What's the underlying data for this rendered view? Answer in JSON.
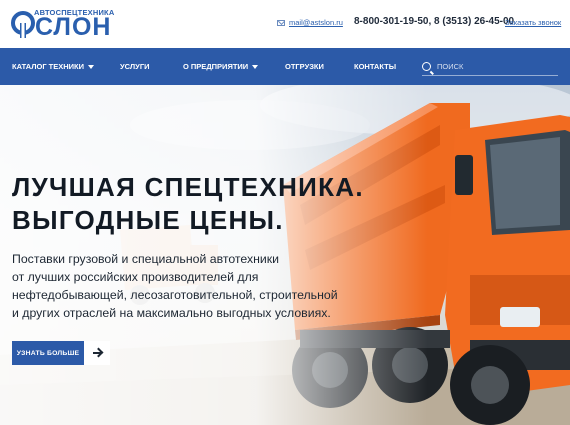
{
  "header": {
    "logo_small": "АВТОСПЕЦТЕХНИКА",
    "logo_big": "СЛОН",
    "email": "mail@astslon.ru",
    "phones": "8-800-301-19-50,  8 (3513) 26-45-00",
    "callback_label": "Заказать звонок"
  },
  "nav": {
    "items": [
      {
        "label": "КАТАЛОГ ТЕХНИКИ",
        "has_dropdown": true
      },
      {
        "label": "УСЛУГИ",
        "has_dropdown": false
      },
      {
        "label": "О ПРЕДПРИЯТИИ",
        "has_dropdown": true
      },
      {
        "label": "ОТГРУЗКИ",
        "has_dropdown": false
      },
      {
        "label": "КОНТАКТЫ",
        "has_dropdown": false
      }
    ],
    "search_placeholder": "ПОИСК"
  },
  "hero": {
    "title_line1": "ЛУЧШАЯ СПЕЦТЕХНИКА.",
    "title_line2": "ВЫГОДНЫЕ ЦЕНЫ.",
    "text_lines": [
      "Поставки грузовой и специальной автотехники",
      "от лучших российских производителей для",
      "нефтедобывающей, лесозаготовительной, строительной",
      "и других отраслей на максимально выгодных условиях."
    ],
    "button_label": "УЗНАТЬ БОЛЬШЕ"
  },
  "colors": {
    "brand_blue": "#2c5aa8",
    "truck_orange": "#f06a1f",
    "text_dark": "#121a24"
  },
  "icons": [
    "mail-icon",
    "search-icon",
    "arrow-right-icon",
    "chevron-down-icon"
  ]
}
